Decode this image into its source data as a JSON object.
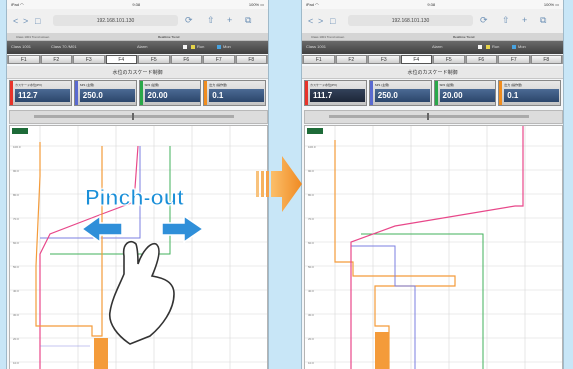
{
  "gesture": {
    "label": "Pinch-out"
  },
  "browser": {
    "address": "192.168.101.130",
    "page_title": "Realtime Trend",
    "tabs": [
      "Class 1001 Trend screen",
      "Class 70 /M01"
    ],
    "nav": {
      "back": "<",
      "forward": ">",
      "book": "□",
      "reload": "⟳",
      "share": "⇧",
      "add": "+",
      "tabs": "⧉"
    }
  },
  "status": {
    "carrier": "iPad ◠",
    "time": "9:38",
    "battery": "100% ▭"
  },
  "menubar": {
    "items": [
      "Class 1001",
      "Alarm",
      "Class 70 /M01",
      "Run",
      "Mon"
    ]
  },
  "function_tabs": [
    "F1",
    "F2",
    "F3",
    "F4",
    "F5",
    "F6",
    "F7",
    "F8"
  ],
  "screen_title": "水位のカスケード制御",
  "panels": [
    {
      "label": "カスケード水位(PV)",
      "value": "112.7",
      "value_right": "111.7",
      "stripe": "#e8332a"
    },
    {
      "label": "SP1 (主側)",
      "value": "250.0",
      "stripe": "#5a6ad0"
    },
    {
      "label": "SP2 (従側)",
      "value": "20.00",
      "stripe": "#2aa84a"
    },
    {
      "label": "出力 (操作量)",
      "value": "0.1",
      "stripe": "#f08c1e"
    }
  ],
  "trend": {
    "y_ticks": [
      "100.0",
      "90.0",
      "80.0",
      "70.0",
      "60.0",
      "50.0",
      "40.0",
      "30.0",
      "20.0",
      "10.0"
    ],
    "colors": {
      "pv": "#e8488a",
      "sp1": "#7b7fe0",
      "sp2": "#41b25b",
      "out": "#f49b3a"
    }
  },
  "colors": {
    "background": "#c8e6f7",
    "arrow": "#f39a3c",
    "label": "#1a8fd8"
  }
}
